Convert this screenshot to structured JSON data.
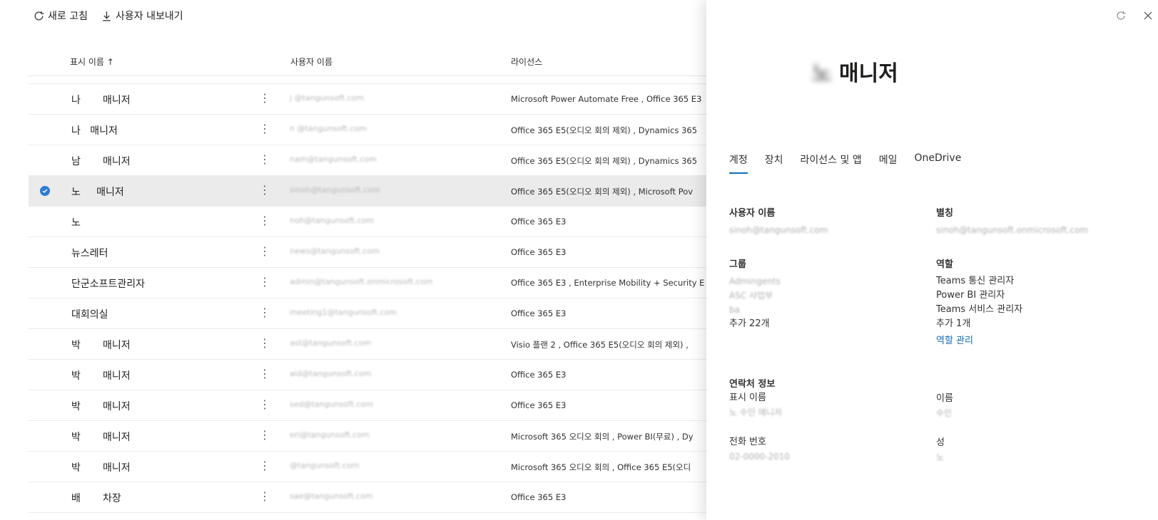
{
  "toolbar": {
    "refresh_label": "새로 고침",
    "export_label": "사용자 내보내기"
  },
  "columns": {
    "display_name": "표시 이름 ↑",
    "username": "사용자 이름",
    "licenses": "라이선스"
  },
  "rows": [
    {
      "name": "나       매니저",
      "user": "j   @tangunsoft.com",
      "lic": "Microsoft Power Automate Free , Office 365 E3"
    },
    {
      "name": "나   매니저",
      "user": "n   @tangunsoft.com",
      "lic": "Office 365 E5(오디오 회의 제외) , Dynamics 365"
    },
    {
      "name": "남       매니저",
      "user": "nam@tangunsoft.com",
      "lic": "Office 365 E5(오디오 회의 제외) , Dynamics 365"
    },
    {
      "name": "노     매니저",
      "user": "sinoh@tangunsoft.com",
      "lic": "Office 365 E5(오디오 회의 제외) , Microsoft Pov"
    },
    {
      "name": "노",
      "user": "noh@tangunsoft.com",
      "lic": "Office 365 E3"
    },
    {
      "name": "뉴스레터",
      "user": "news@tangunsoft.com",
      "lic": "Office 365 E3"
    },
    {
      "name": "단군소프트관리자",
      "user": "admin@tangunsoft.onmicrosoft.com",
      "lic": "Office 365 E3 , Enterprise Mobility + Security E"
    },
    {
      "name": "대회의실",
      "user": "meeting1@tangunsoft.com",
      "lic": "Office 365 E3"
    },
    {
      "name": "박       매니저",
      "user": "ast@tangunsoft.com",
      "lic": "Visio 플랜 2 , Office 365 E5(오디오 회의 제외) ,"
    },
    {
      "name": "박       매니저",
      "user": "aid@tangunsoft.com",
      "lic": "Office 365 E3"
    },
    {
      "name": "박       매니저",
      "user": "sed@tangunsoft.com",
      "lic": "Office 365 E3"
    },
    {
      "name": "박       매니저",
      "user": "eri@tangunsoft.com",
      "lic": "Microsoft 365 오디오 회의 , Power BI(무료) , Dy"
    },
    {
      "name": "박       매니저",
      "user": "@tangunsoft.com",
      "lic": "Microsoft 365 오디오 회의 , Office 365 E5(오디"
    },
    {
      "name": "배       차장",
      "user": "sae@tangunsoft.com",
      "lic": "Office 365 E3"
    }
  ],
  "panel": {
    "title_blur": "노 ",
    "title": "매니저",
    "tabs": [
      "계정",
      "장치",
      "라이선스 및 앱",
      "메일",
      "OneDrive"
    ],
    "username_label": "사용자 이름",
    "username_value": "sinoh@tangunsoft.com",
    "alias_label": "별칭",
    "alias_value": "sinoh@tangunsoft.onmicrosoft.com",
    "groups_label": "그룹",
    "groups": [
      "Admingents",
      "ASC 사업부",
      "ba"
    ],
    "groups_more": "추가 22개",
    "roles_label": "역할",
    "roles": [
      "Teams 통신 관리자",
      "Power BI 관리자",
      "Teams 서비스 관리자"
    ],
    "roles_more": "추가 1개",
    "manage_roles": "역할 관리",
    "contact_label": "연락처 정보",
    "display_name_label": "표시 이름",
    "display_name_value": "노 수민 매니저",
    "first_name_label": "이름",
    "first_name_value": "수민",
    "phone_label": "전화 번호",
    "phone_value": "02-0000-2010",
    "last_name_label": "성",
    "last_name_value": "노"
  }
}
